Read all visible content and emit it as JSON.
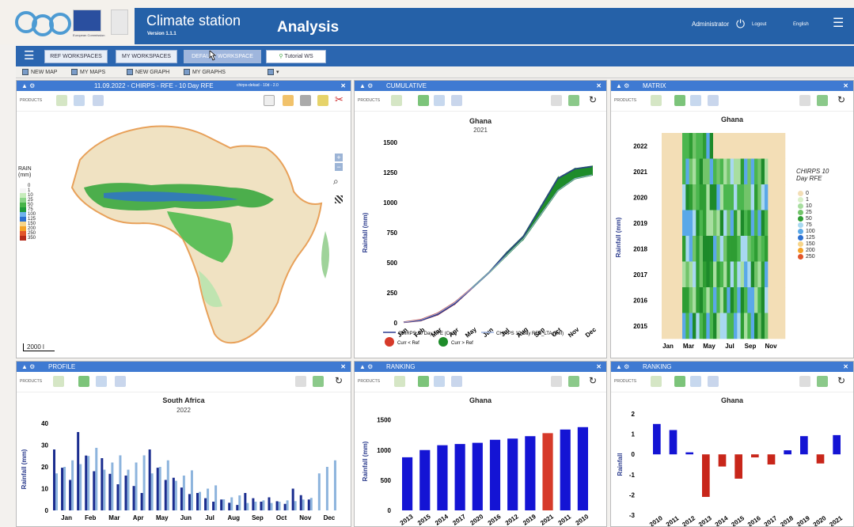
{
  "header": {
    "title": "Climate station",
    "version": "Version 1.1.1",
    "page": "Analysis",
    "user": "Administrator",
    "logout": "Logout",
    "language": "English",
    "logo_caption": "European Commission"
  },
  "tabs": [
    "REF WORKSPACES",
    "MY WORKSPACES",
    "DEFAULT WORKSPACE",
    "Tutorial WS"
  ],
  "toolbar": [
    "NEW MAP",
    "MY MAPS",
    "NEW GRAPH",
    "MY GRAPHS"
  ],
  "map_panel": {
    "title": "11.09.2022 - CHIRPS - RFE - 10 Day RFE",
    "title_small": "chirps-dekad - 10d - 2.0",
    "products": "PRODUCTS",
    "legend_title": "RAIN\n(mm)",
    "legend": [
      "0",
      "1",
      "10",
      "25",
      "50",
      "75",
      "100",
      "125",
      "150",
      "200",
      "250",
      "350"
    ],
    "scale": "2000 l",
    "colors": {
      "low": "#f0e2c2",
      "mid": "#4cae4c",
      "high": "#2d6fcf"
    }
  },
  "cumulative": {
    "panel": "CUMULATIVE",
    "products": "PRODUCTS",
    "title": "Ghana",
    "subtitle": "2021",
    "ylabel": "Rainfall (mm)",
    "legend": [
      "CHIRPS 10 Day RFE (Curr)",
      "CHIRPS 10 Day RFE_LTA (Ref)",
      "Curr < Ref",
      "Curr > Ref"
    ]
  },
  "matrix": {
    "panel": "MATRIX",
    "products": "PRODUCTS",
    "title": "Ghana",
    "ylabel": "Rainfall (mm)",
    "legend_title": "CHIRPS 10\nDay RFE",
    "legend": [
      "0",
      "1",
      "10",
      "25",
      "50",
      "75",
      "100",
      "125",
      "150",
      "200",
      "250"
    ],
    "legend_colors": [
      "#f3deb6",
      "#d8f0c8",
      "#a8dea0",
      "#72c46a",
      "#2e9d33",
      "#a8d8f0",
      "#5aa8e8",
      "#2c6fd0",
      "#f7d58a",
      "#f5a327",
      "#e2562b"
    ],
    "years": [
      "2022",
      "2021",
      "2020",
      "2019",
      "2018",
      "2017",
      "2016",
      "2015"
    ],
    "months": [
      "Jan",
      "Mar",
      "May",
      "Jul",
      "Sep",
      "Nov"
    ]
  },
  "profile": {
    "panel": "PROFILE",
    "products": "PRODUCTS",
    "title": "South Africa",
    "subtitle": "2022",
    "ylabel": "Rainfall (mm)",
    "months": [
      "Jan",
      "Feb",
      "Mar",
      "Apr",
      "May",
      "Jun",
      "Jul",
      "Aug",
      "Sep",
      "Oct",
      "Nov",
      "Dec"
    ]
  },
  "ranking1": {
    "panel": "RANKING",
    "products": "PRODUCTS",
    "title": "Ghana",
    "ylabel": "Rainfall (mm)"
  },
  "ranking2": {
    "panel": "RANKING",
    "products": "PRODUCTS",
    "title": "Ghana",
    "ylabel": "Rainfall"
  },
  "chart_data": [
    {
      "type": "area",
      "title": "Ghana",
      "subtitle": "2021",
      "xlabel": "",
      "ylabel": "Rainfall (mm)",
      "ylim": [
        0,
        1500
      ],
      "categories": [
        "Jan",
        "Feb",
        "Mar",
        "Apr",
        "May",
        "Jun",
        "Jul",
        "Aug",
        "Sep",
        "Oct",
        "Nov",
        "Dec"
      ],
      "series": [
        {
          "name": "CHIRPS 10 Day RFE (Curr)",
          "values": [
            5,
            20,
            70,
            160,
            290,
            420,
            580,
            720,
            960,
            1200,
            1280,
            1300
          ]
        },
        {
          "name": "CHIRPS 10 Day RFE_LTA (Ref)",
          "values": [
            5,
            25,
            80,
            170,
            290,
            420,
            560,
            700,
            900,
            1100,
            1200,
            1230
          ]
        }
      ],
      "yticks": [
        0,
        250,
        500,
        750,
        1000,
        1250,
        1500
      ]
    },
    {
      "type": "bar",
      "title": "South Africa",
      "subtitle": "2022",
      "ylabel": "Rainfall (mm)",
      "ylim": [
        0,
        40
      ],
      "categories": [
        "Jan",
        "Feb",
        "Mar",
        "Apr",
        "May",
        "Jun",
        "Jul",
        "Aug",
        "Sep",
        "Oct",
        "Nov",
        "Dec"
      ],
      "series": [
        {
          "name": "Curr",
          "values": [
            28,
            36,
            24,
            16,
            28,
            15,
            8,
            5,
            8,
            6,
            10,
            0
          ]
        },
        {
          "name": "Ref",
          "values": [
            20,
            25,
            22,
            22,
            20,
            16,
            10,
            6,
            4,
            4,
            5,
            20
          ]
        }
      ],
      "yticks": [
        0,
        10,
        20,
        30,
        40
      ]
    },
    {
      "type": "bar",
      "title": "Ghana",
      "ylabel": "Rainfall (mm)",
      "ylim": [
        0,
        1600
      ],
      "categories": [
        "2013",
        "2015",
        "2014",
        "2017",
        "2020",
        "2016",
        "2012",
        "2019",
        "2021",
        "2011",
        "2010"
      ],
      "values": [
        880,
        1000,
        1080,
        1100,
        1120,
        1170,
        1190,
        1230,
        1280,
        1340,
        1380
      ],
      "highlight": "2021",
      "yticks": [
        0,
        500,
        1000,
        1500
      ]
    },
    {
      "type": "bar",
      "title": "Ghana",
      "ylabel": "Rainfall",
      "ylim": [
        -3,
        2
      ],
      "categories": [
        "2010",
        "2011",
        "2012",
        "2013",
        "2014",
        "2015",
        "2016",
        "2017",
        "2018",
        "2019",
        "2020",
        "2021"
      ],
      "values": [
        1.5,
        1.2,
        0.1,
        -2.1,
        -0.6,
        -1.2,
        -0.15,
        -0.5,
        0.2,
        0.9,
        -0.45,
        0.95
      ],
      "yticks": [
        -3,
        -2,
        -1,
        0,
        1,
        2
      ]
    }
  ]
}
